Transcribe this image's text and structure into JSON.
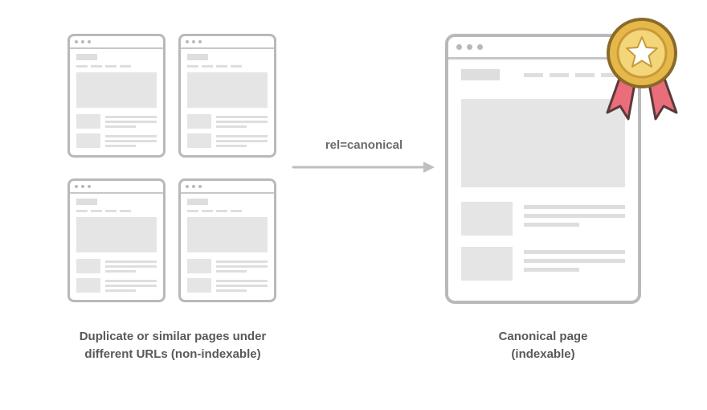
{
  "arrow": {
    "label": "rel=canonical"
  },
  "captions": {
    "left_line1": "Duplicate or similar pages under",
    "left_line2": "different URLs (non-indexable)",
    "right_line1": "Canonical page",
    "right_line2": "(indexable)"
  },
  "icons": {
    "badge": "star-medal-ribbon-icon",
    "arrow": "arrow-right-icon"
  },
  "colors": {
    "outline": "#b9b9b9",
    "fill": "#e5e5e5",
    "text": "#595959",
    "ribbon": "#ea6d7a",
    "medal_outer": "#e6b84a",
    "medal_inner": "#f3d57a",
    "star": "#ffffff"
  }
}
